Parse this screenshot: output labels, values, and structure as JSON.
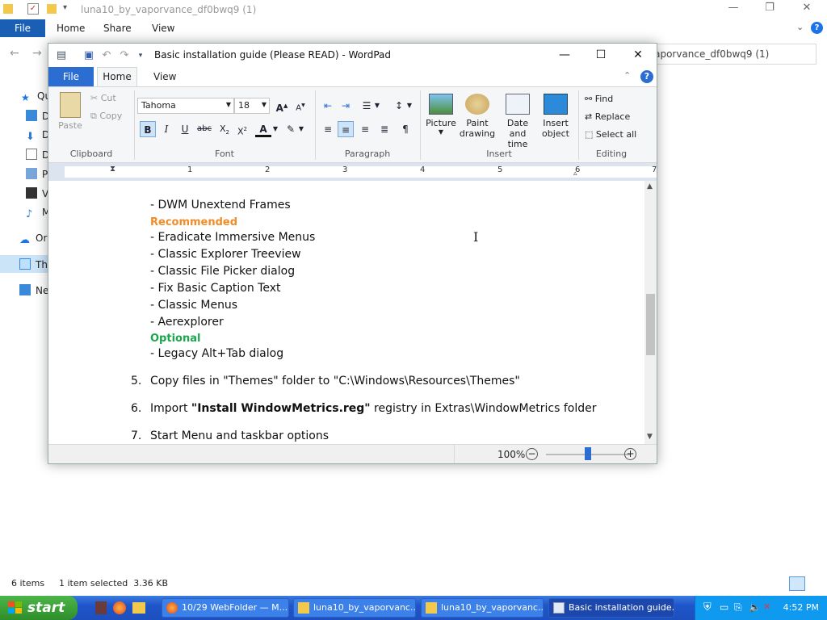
{
  "explorer": {
    "title": "luna10_by_vaporvance_df0bwq9 (1)",
    "tabs": [
      "File",
      "Home",
      "Share",
      "View"
    ],
    "address": "vaporvance_df0bwq9 (1)",
    "nav": [
      "Qu",
      "D",
      "D",
      "D",
      "P",
      "V",
      "M",
      "Or",
      "Th",
      "Ne"
    ],
    "status_items": "6 items",
    "status_selected": "1 item selected  3.36 KB"
  },
  "wordpad": {
    "title": "Basic installation guide (Please READ) - WordPad",
    "tabs": {
      "file": "File",
      "home": "Home",
      "view": "View"
    },
    "ribbon": {
      "clipboard": {
        "paste": "Paste",
        "cut": "Cut",
        "copy": "Copy",
        "label": "Clipboard"
      },
      "font": {
        "family": "Tahoma",
        "size": "18",
        "label": "Font"
      },
      "paragraph": {
        "label": "Paragraph"
      },
      "insert": {
        "picture": "Picture",
        "paint1": "Paint",
        "paint2": "drawing",
        "date1": "Date and",
        "date2": "time",
        "obj1": "Insert",
        "obj2": "object",
        "label": "Insert"
      },
      "editing": {
        "find": "Find",
        "replace": "Replace",
        "select_all": "Select all",
        "label": "Editing"
      }
    },
    "ruler": [
      "1",
      "2",
      "3",
      "4",
      "5",
      "6",
      "7"
    ],
    "document": {
      "lines": [
        "- DWM Unextend Frames",
        "Recommended",
        "- Eradicate Immersive Menus",
        "- Classic Explorer Treeview",
        "- Classic File Picker dialog",
        "- Fix Basic Caption Text",
        "- Classic Menus",
        "- Aerexplorer",
        "Optional",
        "- Legacy Alt+Tab dialog"
      ],
      "steps": [
        {
          "num": "5.",
          "pre": "Copy files in \"Themes\" folder to \"C:\\Windows\\Resources\\Themes\"",
          "bold": "",
          "post": ""
        },
        {
          "num": "6.",
          "pre": "Import ",
          "bold": "\"Install WindowMetrics.reg\"",
          "post": " registry in Extras\\WindowMetrics folder"
        },
        {
          "num": "7.",
          "pre": "Start Menu and taskbar options",
          "bold": "",
          "post": ""
        }
      ]
    },
    "zoom": "100%",
    "zoom_level": 0.5
  },
  "taskbar": {
    "start": "start",
    "buttons": [
      "10/29 WebFolder — M...",
      "luna10_by_vaporvanc...",
      "luna10_by_vaporvanc...",
      "Basic installation guide..."
    ],
    "clock": "4:52 PM"
  }
}
